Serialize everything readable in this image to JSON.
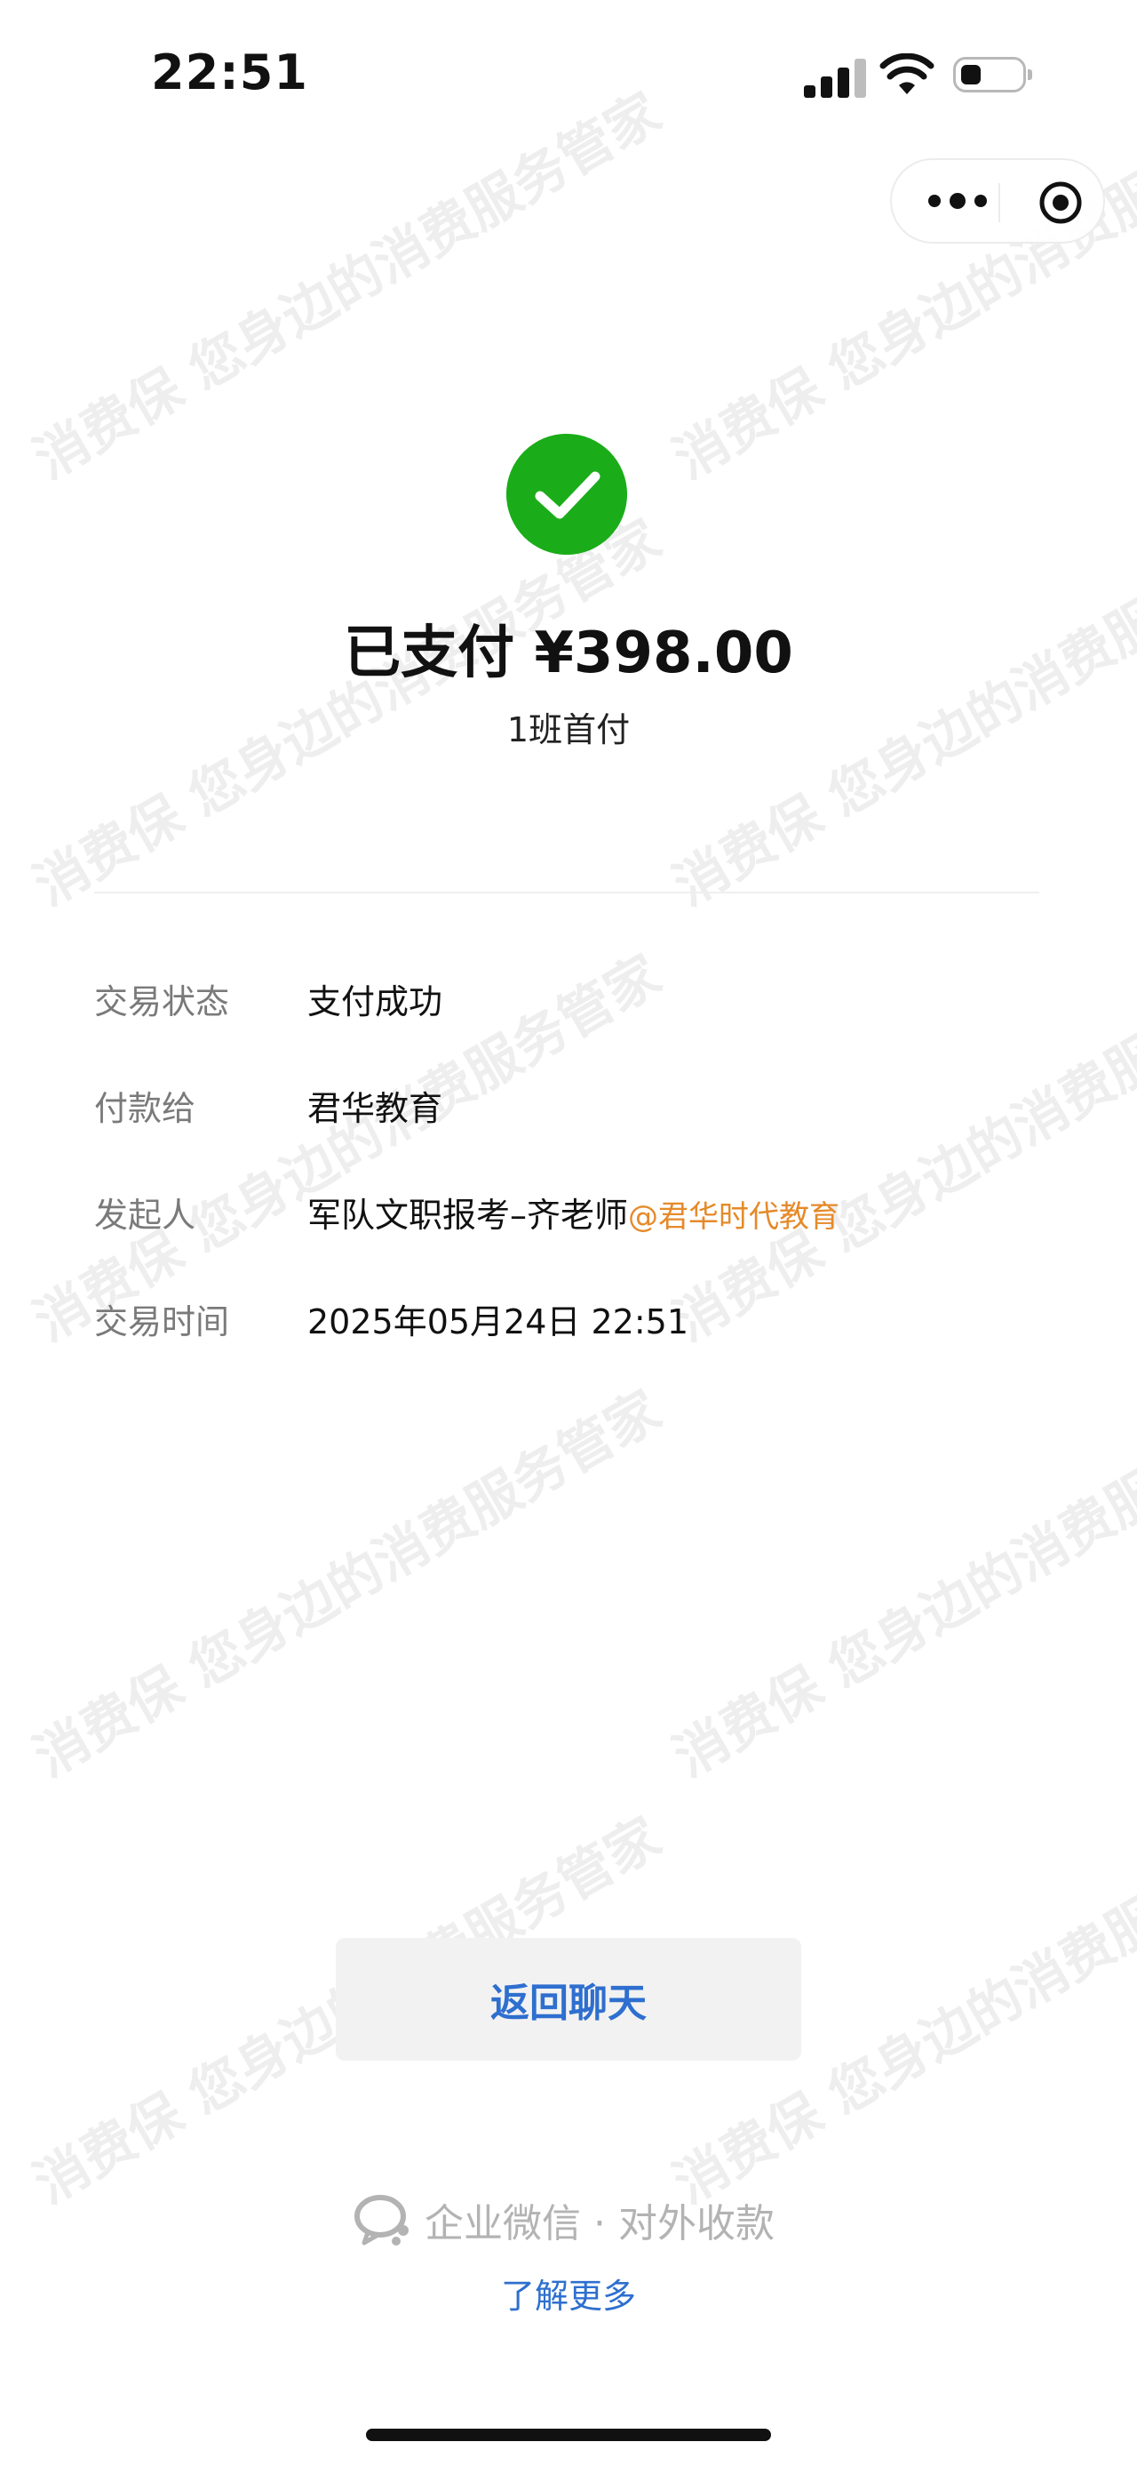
{
  "status_bar": {
    "time": "22:51"
  },
  "capsule": {
    "more_icon": "more-dots-icon",
    "close_icon": "target-circle-icon"
  },
  "watermark": {
    "text": "消费保 您身边的消费服务管家"
  },
  "header": {
    "status_icon": "check-circle-icon",
    "title": "已支付 ¥398.00",
    "subtitle": "1班首付"
  },
  "details": {
    "status_label": "交易状态",
    "status_value": "支付成功",
    "payee_label": "付款给",
    "payee_value": "君华教育",
    "initiator_label": "发起人",
    "initiator_name": "军队文职报考–齐老师",
    "initiator_org": "@君华时代教育",
    "time_label": "交易时间",
    "time_value": "2025年05月24日 22:51"
  },
  "actions": {
    "back_label": "返回聊天"
  },
  "footer": {
    "brand_text": "企业微信 · 对外收款",
    "learn_more": "了解更多"
  },
  "colors": {
    "success": "#1aad19",
    "link": "#2e6fcf",
    "org": "#e58a2a"
  }
}
